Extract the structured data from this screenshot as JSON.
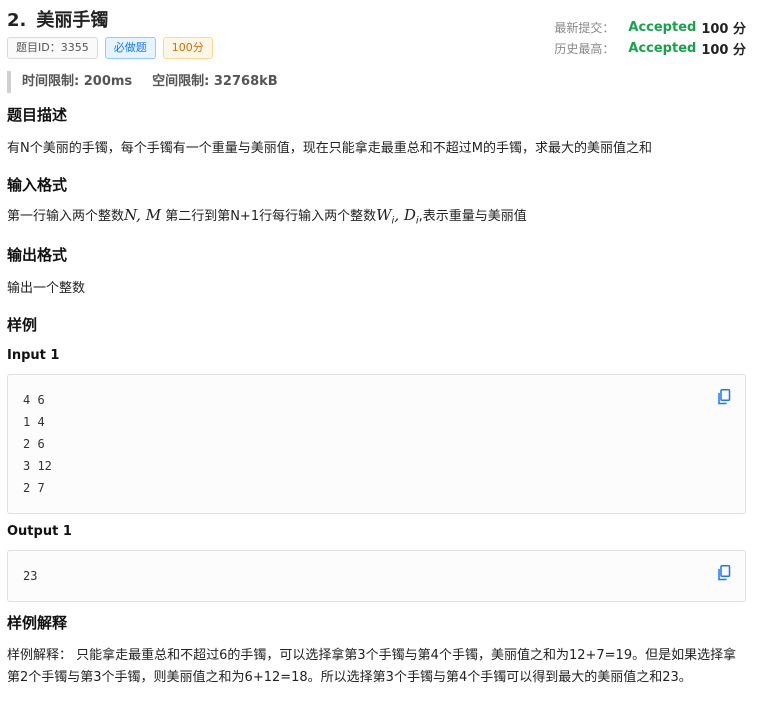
{
  "problem": {
    "number": "2.",
    "title": "美丽手镯"
  },
  "tags": {
    "id_tag": "题目ID：3355",
    "must_tag": "必做题",
    "score_tag": "100分"
  },
  "status": {
    "latest_label": "最新提交：",
    "latest_result": "Accepted",
    "latest_points": "100 分",
    "best_label": "历史最高：",
    "best_result": "Accepted",
    "best_points": "100 分"
  },
  "limits": {
    "time": "时间限制: 200ms",
    "memory": "空间限制: 32768kB"
  },
  "sections": {
    "description_heading": "题目描述",
    "description": "有N个美丽的手镯，每个手镯有一个重量与美丽值，现在只能拿走最重总和不超过M的手镯，求最大的美丽值之和",
    "input_heading": "输入格式",
    "input_part1": "第一行输入两个整数",
    "input_math1": "N, M",
    "input_part2": " 第二行到第N+1行每行输入两个整数",
    "input_math2a": "W",
    "input_math2b": "i",
    "input_math2c": ", D",
    "input_math2d": "i",
    "input_part3": ",表示重量与美丽值",
    "output_heading": "输出格式",
    "output": "输出一个整数",
    "sample_heading": "样例",
    "explain_heading": "样例解释"
  },
  "samples": {
    "input_label": "Input 1",
    "input_text": "4 6\n1 4\n2 6\n3 12\n2 7",
    "output_label": "Output 1",
    "output_text": "23"
  },
  "explanation": "样例解释： 只能拿走最重总和不超过6的手镯，可以选择拿第3个手镯与第4个手镯，美丽值之和为12+7=19。但是如果选择拿第2个手镯与第3个手镯，则美丽值之和为6+12=18。所以选择第3个手镯与第4个手镯可以得到最大的美丽值之和23。",
  "colors": {
    "accepted": "#16a34a",
    "must_tag": "#1677ff",
    "score_tag": "#d46b08"
  }
}
